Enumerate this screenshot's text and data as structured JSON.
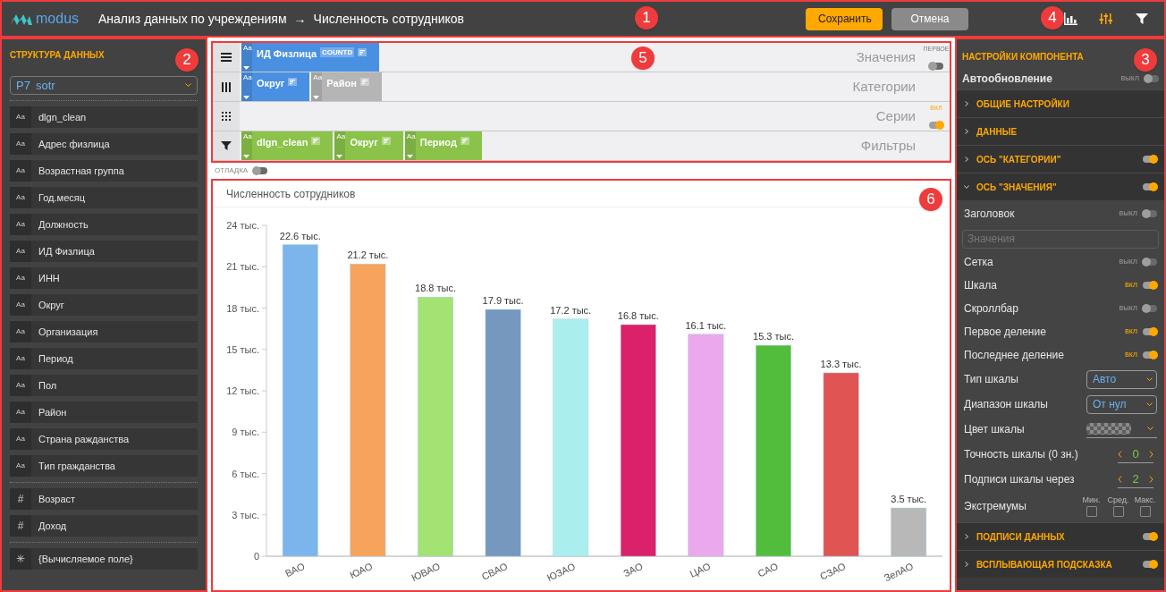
{
  "header": {
    "logo": "modus",
    "breadcrumb": [
      "Анализ данных по учреждениям",
      "→",
      "Численность сотрудников"
    ],
    "buttons": [
      {
        "label": "Сохранить",
        "kind": "primary"
      },
      {
        "label": "Отмена",
        "kind": "secondary"
      }
    ],
    "tools": [
      {
        "kind": "chart",
        "selected": false
      },
      {
        "kind": "sliders",
        "selected": true
      },
      {
        "kind": "filter",
        "selected": false
      }
    ],
    "callouts": [
      "1",
      "4"
    ]
  },
  "structure": {
    "title": "СТРУКТУРА ДАННЫХ",
    "callout": "2",
    "source": {
      "prefix": "P7",
      "value": "sotr"
    },
    "groups": [
      [
        {
          "type": "Aa",
          "name": "dlgn_clean"
        },
        {
          "type": "Aa",
          "name": "Адрес физлица"
        },
        {
          "type": "Aa",
          "name": "Возрастная группа"
        },
        {
          "type": "Aa",
          "name": "Год.месяц"
        },
        {
          "type": "Aa",
          "name": "Должность"
        },
        {
          "type": "Aa",
          "name": "ИД Физлица"
        },
        {
          "type": "Aa",
          "name": "ИНН"
        },
        {
          "type": "Aa",
          "name": "Округ"
        },
        {
          "type": "Aa",
          "name": "Организация"
        },
        {
          "type": "Aa",
          "name": "Период"
        },
        {
          "type": "Aa",
          "name": "Пол"
        },
        {
          "type": "Aa",
          "name": "Район"
        },
        {
          "type": "Aa",
          "name": "Страна ражданства"
        },
        {
          "type": "Aa",
          "name": "Тип гражданства"
        }
      ],
      [
        {
          "type": "#",
          "name": "Возраст"
        },
        {
          "type": "#",
          "name": "Доход"
        }
      ],
      [
        {
          "type": "✳",
          "name": "{Вычисляемое поле}"
        }
      ]
    ]
  },
  "shelves": {
    "callout": "5",
    "rows": [
      {
        "kind": "rows",
        "label": "Значения",
        "chips": [
          {
            "type": "Aa",
            "name": "ИД Физлица",
            "agg": "COUNTD",
            "color": "#4a90e2"
          }
        ],
        "toggle": {
          "caption": "ПЕРВОЕ",
          "on": false
        }
      },
      {
        "kind": "columns",
        "label": "Категории",
        "chips": [
          {
            "type": "Aa",
            "name": "Округ",
            "color": "#4a90e2"
          },
          {
            "type": "Aa",
            "name": "Район",
            "color": "#b5b5b5"
          }
        ]
      },
      {
        "kind": "grid",
        "label": "Серии",
        "chips": [],
        "toggle": {
          "caption": "ВКЛ",
          "on": true
        }
      },
      {
        "kind": "filter",
        "label": "Фильтры",
        "chips": [
          {
            "type": "Aa",
            "name": "dlgn_clean",
            "color": "#8bc34a"
          },
          {
            "type": "Aa",
            "name": "Округ",
            "color": "#8bc34a"
          },
          {
            "type": "Aa",
            "name": "Период",
            "color": "#8bc34a"
          }
        ]
      }
    ],
    "debug": {
      "label": "ОТЛАДКА",
      "on": false
    }
  },
  "chart": {
    "title": "Численность сотрудников",
    "callout": "6",
    "chart_data": {
      "type": "bar",
      "categories": [
        "ВАО",
        "ЮАО",
        "ЮВАО",
        "СВАО",
        "ЮЗАО",
        "ЗАО",
        "ЦАО",
        "САО",
        "СЗАО",
        "ЗелАО"
      ],
      "series": [
        {
          "values": [
            22.6,
            21.2,
            18.8,
            17.9,
            17.2,
            16.8,
            16.1,
            15.3,
            13.3,
            3.5
          ]
        }
      ],
      "colors": [
        "#7cb5ec",
        "#f7a35c",
        "#a3e374",
        "#7698be",
        "#aaeeee",
        "#db2169",
        "#eba8ec",
        "#52bd3c",
        "#e05554",
        "#b8b8b8"
      ],
      "ylim": [
        0,
        24
      ],
      "yticks": [
        {
          "value": 0,
          "label": "0"
        },
        {
          "value": 3,
          "label": "3 тыс."
        },
        {
          "value": 6,
          "label": "6 тыс."
        },
        {
          "value": 9,
          "label": "9 тыс."
        },
        {
          "value": 12,
          "label": "12 тыс."
        },
        {
          "value": 15,
          "label": "15 тыс."
        },
        {
          "value": 18,
          "label": "18 тыс."
        },
        {
          "value": 21,
          "label": "21 тыс."
        },
        {
          "value": 24,
          "label": "24 тыс."
        }
      ],
      "value_labels": [
        "22.6 тыс.",
        "21.2 тыс.",
        "18.8 тыс.",
        "17.9 тыс.",
        "17.2 тыс.",
        "16.8 тыс.",
        "16.1 тыс.",
        "15.3 тыс.",
        "13.3 тыс.",
        "3.5 тыс."
      ]
    }
  },
  "settings": {
    "title": "НАСТРОЙКИ КОМПОНЕНТА",
    "callout": "3",
    "autoupdate": {
      "label": "Автообновление",
      "state": "выкл",
      "on": false
    },
    "sections": [
      {
        "title": "ОБЩИЕ НАСТРОЙКИ",
        "expanded": false
      },
      {
        "title": "ДАННЫЕ",
        "expanded": false
      },
      {
        "title": "ОСЬ \"КАТЕГОРИИ\"",
        "expanded": false,
        "on": true
      },
      {
        "title": "ОСЬ \"ЗНАЧЕНИЯ\"",
        "expanded": true,
        "on": true,
        "rows": [
          {
            "kind": "toggle",
            "label": "Заголовок",
            "state": "выкл",
            "on": false
          },
          {
            "kind": "field",
            "placeholder": "Значения"
          },
          {
            "kind": "toggle",
            "label": "Сетка",
            "state": "выкл",
            "on": false
          },
          {
            "kind": "toggle",
            "label": "Шкала",
            "state": "вкл",
            "on": true
          },
          {
            "kind": "toggle",
            "label": "Скроллбар",
            "state": "выкл",
            "on": false
          },
          {
            "kind": "toggle",
            "label": "Первое деление",
            "state": "вкл",
            "on": true
          },
          {
            "kind": "toggle",
            "label": "Последнее деление",
            "state": "вкл",
            "on": true
          },
          {
            "kind": "select",
            "label": "Тип шкалы",
            "value": "Авто"
          },
          {
            "kind": "select",
            "label": "Диапазон шкалы",
            "value": "От нул"
          },
          {
            "kind": "color",
            "label": "Цвет шкалы"
          },
          {
            "kind": "stepper",
            "label": "Точность шкалы (0 зн.)",
            "value": "0"
          },
          {
            "kind": "stepper",
            "label": "Подписи шкалы через",
            "value": "2"
          },
          {
            "kind": "checks",
            "label": "Экстремумы",
            "options": [
              {
                "label": "Мин.",
                "checked": false
              },
              {
                "label": "Сред.",
                "checked": false
              },
              {
                "label": "Макс.",
                "checked": false
              }
            ]
          }
        ]
      },
      {
        "title": "ПОДПИСИ ДАННЫХ",
        "expanded": false,
        "on": true
      },
      {
        "title": "ВСПЛЫВАЮЩАЯ ПОДСКАЗКА",
        "expanded": false,
        "on": true
      }
    ]
  }
}
